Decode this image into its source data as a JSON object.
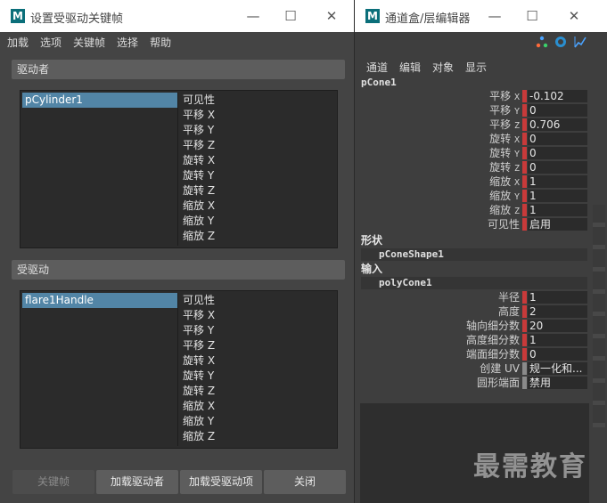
{
  "sdk": {
    "title": "设置受驱动关键帧",
    "menu": [
      "加载",
      "选项",
      "关键帧",
      "选择",
      "帮助"
    ],
    "driver": {
      "header": "驱动者",
      "node": "pCylinder1",
      "attrs": [
        "可见性",
        "平移 X",
        "平移 Y",
        "平移 Z",
        "旋转 X",
        "旋转 Y",
        "旋转 Z",
        "缩放 X",
        "缩放 Y",
        "缩放 Z"
      ]
    },
    "driven": {
      "header": "受驱动",
      "node": "flare1Handle",
      "attrs": [
        "可见性",
        "平移 X",
        "平移 Y",
        "平移 Z",
        "旋转 X",
        "旋转 Y",
        "旋转 Z",
        "缩放 X",
        "缩放 Y",
        "缩放 Z"
      ]
    },
    "buttons": {
      "key": "关键帧",
      "load_driver": "加载驱动者",
      "load_driven": "加载受驱动项",
      "close": "关闭"
    }
  },
  "cb": {
    "title": "通道盒/层编辑器",
    "menu": [
      "通道",
      "编辑",
      "对象",
      "显示"
    ],
    "node": "pCone1",
    "channels": [
      {
        "label": "平移",
        "axis": "X",
        "value": "-0.102"
      },
      {
        "label": "平移",
        "axis": "Y",
        "value": "0"
      },
      {
        "label": "平移",
        "axis": "Z",
        "value": "0.706"
      },
      {
        "label": "旋转",
        "axis": "X",
        "value": "0"
      },
      {
        "label": "旋转",
        "axis": "Y",
        "value": "0"
      },
      {
        "label": "旋转",
        "axis": "Z",
        "value": "0"
      },
      {
        "label": "缩放",
        "axis": "X",
        "value": "1"
      },
      {
        "label": "缩放",
        "axis": "Y",
        "value": "1"
      },
      {
        "label": "缩放",
        "axis": "Z",
        "value": "1"
      },
      {
        "label": "可见性",
        "axis": "",
        "value": "启用"
      }
    ],
    "shapes_header": "形状",
    "shape_node": "pConeShape1",
    "inputs_header": "输入",
    "input_node": "polyCone1",
    "input_channels": [
      {
        "label": "半径",
        "value": "1"
      },
      {
        "label": "高度",
        "value": "2"
      },
      {
        "label": "轴向细分数",
        "value": "20"
      },
      {
        "label": "高度细分数",
        "value": "1"
      },
      {
        "label": "端面细分数",
        "value": "0"
      },
      {
        "label": "创建 UV",
        "value": "规一化和..."
      },
      {
        "label": "圆形端面",
        "value": "禁用"
      }
    ]
  },
  "watermark": "最需教育",
  "colors": {
    "selection": "#5285a6",
    "keyed": "#c83a3a",
    "panel_bg": "#444444"
  }
}
